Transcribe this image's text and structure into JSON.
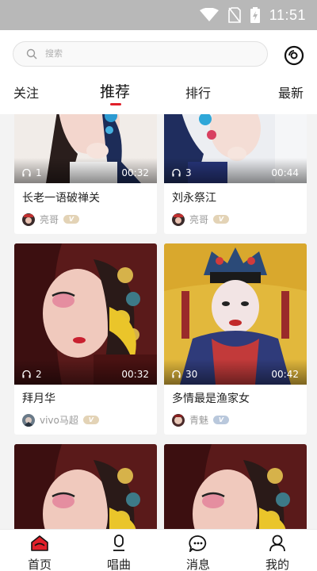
{
  "status_bar": {
    "time": "11:51"
  },
  "search": {
    "placeholder": "搜索"
  },
  "tabs": [
    {
      "label": "关注"
    },
    {
      "label": "推荐"
    },
    {
      "label": "排行"
    },
    {
      "label": "最新"
    }
  ],
  "active_tab": "推荐",
  "cards": [
    {
      "title": "长老一语破禅关",
      "plays": "1",
      "duration": "00:32",
      "author": "亮哥",
      "badge": "V"
    },
    {
      "title": "刘永祭江",
      "plays": "3",
      "duration": "00:44",
      "author": "亮哥",
      "badge": "V"
    },
    {
      "title": "拜月华",
      "plays": "2",
      "duration": "00:32",
      "author": "vivo马超",
      "badge": "V"
    },
    {
      "title": "多情最是渔家女",
      "plays": "30",
      "duration": "00:42",
      "author": "青魅",
      "badge": "V"
    }
  ],
  "bottom_nav": [
    {
      "label": "首页"
    },
    {
      "label": "唱曲"
    },
    {
      "label": "消息"
    },
    {
      "label": "我的"
    }
  ],
  "colors": {
    "accent": "#e0202a",
    "status_bar": "#b8b8b8"
  }
}
